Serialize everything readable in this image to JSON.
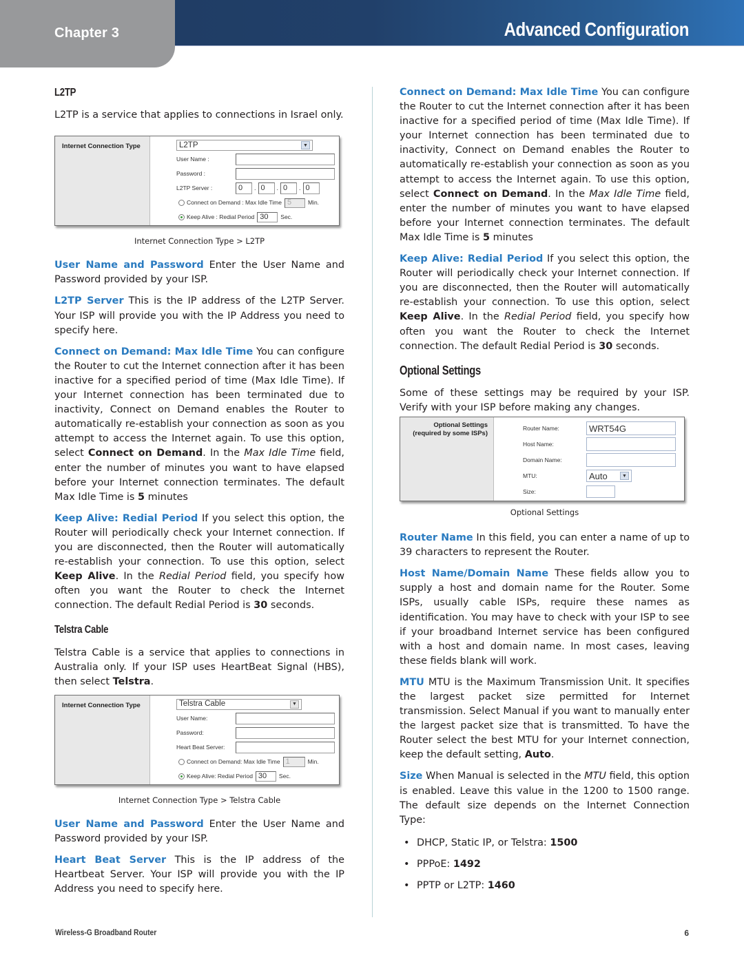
{
  "header": {
    "chapter": "Chapter 3",
    "title": "Advanced Configuration",
    "colors": {
      "band_dark": "#1f3a60",
      "band_light": "#2e72b8",
      "chapter_tab": "#98999b",
      "term_blue": "#2a7bc0"
    }
  },
  "left": {
    "l2tp": {
      "heading": "L2TP",
      "intro": "L2TP is a service that applies to connections in Israel only.",
      "figure": {
        "side_label": "Internet Connection Type",
        "connection_type": "L2TP",
        "user_name_label": "User Name :",
        "user_name_value": "",
        "password_label": "Password :",
        "password_value": "",
        "server_label": "L2TP Server :",
        "server_octets": [
          "0",
          "0",
          "0",
          "0"
        ],
        "cod_label": "Connect on Demand : Max Idle Time",
        "cod_value": "5",
        "cod_unit": "Min.",
        "keepalive_label": "Keep Alive : Redial Period",
        "keepalive_value": "30",
        "keepalive_unit": "Sec.",
        "selected_mode": "keep_alive",
        "caption": "Internet Connection Type > L2TP"
      },
      "p_user": {
        "term": "User Name and Password",
        "text": " Enter the User Name and Password provided by your ISP."
      },
      "p_server": {
        "term": "L2TP Server",
        "text": " This is the IP address of the L2TP Server. Your ISP will provide you with the IP Address you need to specify here."
      },
      "p_cod": {
        "term": "Connect on Demand: Max Idle Time",
        "t1": "  You can configure the Router to cut the Internet connection after it has been inactive for a specified period of time (Max Idle Time). If your Internet connection has been terminated due to inactivity, Connect on Demand enables the Router to automatically re-establish your connection as soon as you attempt to access the Internet again. To use this option, select ",
        "b1": "Connect on Demand",
        "t2": ". In the ",
        "i1": "Max Idle Time",
        "t3": " field, enter the number of minutes you want to have elapsed before your Internet connection terminates. The default Max Idle Time is ",
        "b2": "5",
        "t4": " minutes"
      },
      "p_keep": {
        "term": "Keep Alive: Redial Period",
        "t1": " If you select this option, the Router will periodically check your Internet connection. If you are disconnected, then the Router will automatically re-establish your connection. To use this option, select ",
        "b1": "Keep Alive",
        "t2": ". In the ",
        "i1": "Redial Period",
        "t3": " field, you specify how often you want the Router to check the Internet connection. The default Redial Period is ",
        "b2": "30",
        "t4": " seconds."
      }
    },
    "telstra": {
      "heading": "Telstra Cable",
      "intro_t1": "Telstra Cable is a service that applies to connections in Australia only. If your ISP uses HeartBeat Signal (HBS), then select ",
      "intro_b1": "Telstra",
      "intro_t2": ".",
      "figure": {
        "side_label": "Internet Connection Type",
        "connection_type": "Telstra Cable",
        "user_name_label": "User Name:",
        "user_name_value": "",
        "password_label": "Password:",
        "password_value": "",
        "hb_label": "Heart Beat Server:",
        "hb_value": "",
        "cod_label": "Connect on Demand: Max Idle Time",
        "cod_value": "1",
        "cod_unit": "Min.",
        "keepalive_label": "Keep Alive: Redial Period",
        "keepalive_value": "30",
        "keepalive_unit": "Sec.",
        "selected_mode": "keep_alive",
        "caption": "Internet Connection Type > Telstra Cable"
      },
      "p_user": {
        "term": "User Name and Password",
        "text": " Enter the User Name and Password provided by your ISP."
      },
      "p_hb": {
        "term": "Heart Beat Server",
        "text": "  This is the IP address of the Heartbeat Server. Your ISP will provide you with the IP Address you need to specify here."
      }
    }
  },
  "right": {
    "p_cod": {
      "term": "Connect on Demand: Max Idle Time",
      "t1": "  You can configure the Router to cut the Internet connection after it has been inactive for a specified period of time (Max Idle Time). If your Internet connection has been terminated due to inactivity, Connect on Demand enables the Router to automatically re-establish your connection as soon as you attempt to access the Internet again. To use this option, select ",
      "b1": "Connect on Demand",
      "t2": ". In the ",
      "i1": "Max Idle Time",
      "t3": " field, enter the number of minutes you want to have elapsed before your Internet connection terminates. The default Max Idle Time is ",
      "b2": "5",
      "t4": " minutes"
    },
    "p_keep": {
      "term": "Keep Alive: Redial Period",
      "t1": " If you select this option, the Router will periodically check your Internet connection. If you are disconnected, then the Router will automatically re-establish your connection. To use this option, select ",
      "b1": "Keep Alive",
      "t2": ". In the ",
      "i1": "Redial Period",
      "t3": " field, you specify how often you want the Router to check the Internet connection. The default Redial Period is ",
      "b2": "30",
      "t4": " seconds."
    },
    "optional": {
      "heading": "Optional Settings",
      "intro": "Some of these settings may be required by your ISP. Verify with your ISP before making any changes.",
      "figure": {
        "side_label_1": "Optional Settings",
        "side_label_2": "(required by some ISPs)",
        "router_name_label": "Router Name:",
        "router_name_value": "WRT54G",
        "host_name_label": "Host Name:",
        "host_name_value": "",
        "domain_name_label": "Domain Name:",
        "domain_name_value": "",
        "mtu_label": "MTU:",
        "mtu_value": "Auto",
        "size_label": "Size:",
        "size_value": "",
        "caption": "Optional Settings"
      },
      "p_router": {
        "term": "Router Name",
        "text": "  In this field, you can enter a name of up to 39 characters to represent the Router."
      },
      "p_host": {
        "term": "Host Name/Domain Name",
        "text": " These fields allow you to supply a host and domain name for the Router. Some ISPs, usually cable ISPs, require these names as identification. You may have to check with your ISP to see if your broadband Internet service has been configured with a host and domain name. In most cases, leaving these fields blank will work."
      },
      "p_mtu": {
        "term": "MTU",
        "t1": "  MTU is the Maximum Transmission Unit. It specifies the largest packet size permitted for Internet transmission. Select Manual if you want to manually enter the largest packet size that is transmitted. To have the Router select the best MTU for your Internet connection, keep the default setting, ",
        "b1": "Auto",
        "t2": "."
      },
      "p_size": {
        "term": "Size",
        "t1": "  When Manual is selected in the ",
        "i1": "MTU",
        "t2": " field, this option is enabled. Leave this value in the 1200 to 1500 range. The default size depends on the Internet Connection Type:"
      },
      "bullets": [
        {
          "label": "DHCP, Static IP, or Telstra: ",
          "value": "1500"
        },
        {
          "label": "PPPoE: ",
          "value": "1492"
        },
        {
          "label": "PPTP or L2TP: ",
          "value": "1460"
        }
      ]
    }
  },
  "footer": {
    "product": "Wireless-G Broadband Router",
    "page_number": "6"
  }
}
